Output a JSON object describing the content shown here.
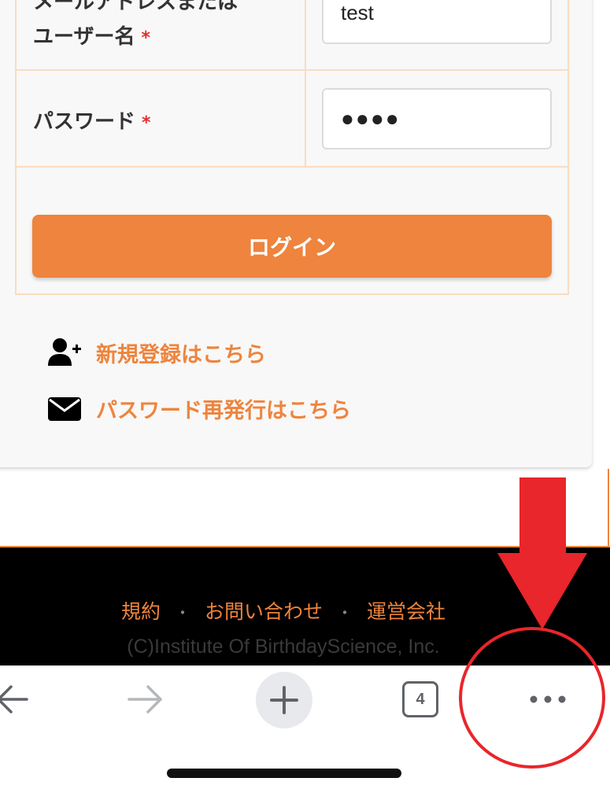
{
  "form": {
    "username_label": "ユーザー名",
    "username_label_top_partial": "メールアドレスまたは",
    "required_mark": "*",
    "username_value": "test",
    "password_label": "パスワード",
    "password_value": "●●●●",
    "login_button": "ログイン"
  },
  "links": {
    "register": "新規登録はこちら",
    "reset_password": "パスワード再発行はこちら"
  },
  "footer": {
    "terms": "規約",
    "contact": "お問い合わせ",
    "company": "運営会社",
    "separator": "・",
    "copyright": "(C)Institute Of BirthdayScience, Inc."
  },
  "toolbar": {
    "tab_count": "4"
  },
  "colors": {
    "accent": "#ee843d",
    "annotation": "#e8262b",
    "required": "#e0302a"
  }
}
